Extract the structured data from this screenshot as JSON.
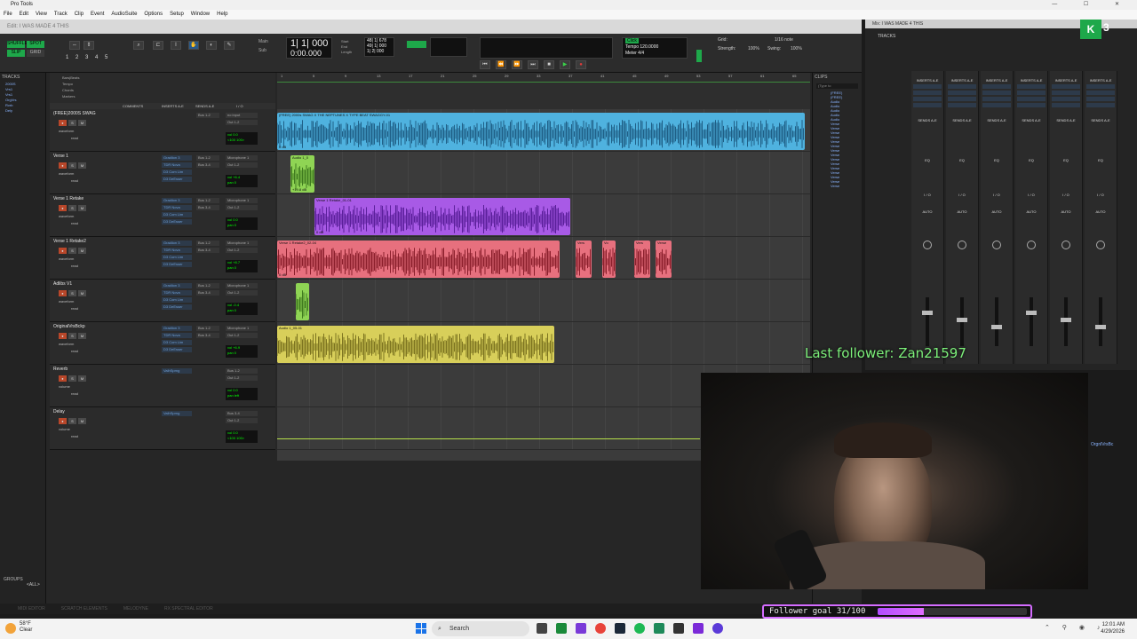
{
  "window_title": "Pro Tools",
  "menu": [
    "File",
    "Edit",
    "View",
    "Track",
    "Clip",
    "Event",
    "AudioSuite",
    "Options",
    "Setup",
    "Window",
    "Help"
  ],
  "edit_window_title": "Edit: I WAS MADE 4 THIS",
  "mix_window_title": "Mix: I WAS MADE 4 THIS",
  "transport": {
    "main_counter": "1| 1| 000",
    "sub_counter": "0:00.000",
    "start": "48| 1| 678",
    "end": "49| 1| 000",
    "length": "1| 2| 000",
    "main_label": "Main",
    "sub_label": "Sub",
    "tempo": "120.0000",
    "meter": "4/4",
    "grid_label": "Grid:",
    "grid_value": "1/16 note",
    "strength_label": "Strength:",
    "strength_value": "100%",
    "swing_label": "Swing:",
    "swing_value": "100%",
    "shuffle_label": "SHUFFLE",
    "spot_label": "SPOT",
    "slip_label": "SLIP",
    "grid_mode_label": "GRID",
    "counter_num": "1"
  },
  "ruler": {
    "bars_label": "Bars|Beats",
    "rows": [
      "Tempo",
      "Chords",
      "Markers"
    ],
    "bar_numbers": [
      "1",
      "5",
      "9",
      "13",
      "17",
      "21",
      "25",
      "29",
      "33",
      "37",
      "41",
      "45",
      "49",
      "53",
      "57",
      "61",
      "65"
    ]
  },
  "columns": {
    "comments": "COMMENTS",
    "inserts": "INSERTS A-E",
    "sends": "SENDS A-E",
    "io": "I / O"
  },
  "tracks_panel_label": "TRACKS",
  "groups_panel_label": "GROUPS",
  "groups_all_label": "<ALL>",
  "clips_panel_label": "CLIPS",
  "clips_search_placeholder": "(Type to",
  "clip_list": [
    "(FREE)",
    "(FREE)",
    "Audio",
    "Audio",
    "Audio",
    "Audio",
    "Audio",
    "Verse",
    "Verse",
    "Verse",
    "Verse",
    "Verse",
    "Verse",
    "Verse",
    "Verse",
    "Verse",
    "Verse",
    "Verse",
    "Verse",
    "Verse",
    "Verse",
    "Verse"
  ],
  "track_list": [
    "2000S",
    "Vrs1",
    "Vrs1",
    "OrgVrs",
    "Rvrb",
    "Dely"
  ],
  "tracks": [
    {
      "name": "(FREE)2000S SWAG",
      "color": "#4ba3d4",
      "inserts": [],
      "sends": [
        "Bus 1-2"
      ],
      "input": "no input",
      "output": "Out 1-2",
      "vol": "vol 0.0",
      "pan": "<100 100>",
      "view": "waveform",
      "mode": "read"
    },
    {
      "name": "Verse 1",
      "color": "#7fc74a",
      "inserts": [
        "Gradiion 3",
        "TDR Nova",
        "D3 Com Lim",
        "D3 DeEsser"
      ],
      "sends": [
        "Bus 1-2",
        "Bus 3-4"
      ],
      "input": "Microphone 1",
      "output": "Out 1-2",
      "vol": "vol +6.4",
      "pan": "pan 0",
      "view": "waveform",
      "mode": "read"
    },
    {
      "name": "Verse 1 Retake",
      "color": "#9b43e0",
      "inserts": [
        "Gradiion 3",
        "TDR Nova",
        "D3 Com Lim",
        "D3 DeEsser"
      ],
      "sends": [
        "Bus 1-2",
        "Bus 3-4"
      ],
      "input": "Microphone 1",
      "output": "Out 1-2",
      "vol": "vol 0.0",
      "pan": "pan 0",
      "view": "waveform",
      "mode": "read"
    },
    {
      "name": "Verse 1 Retake2",
      "color": "#e05c6b",
      "inserts": [
        "Gradiion 3",
        "TDR Nova",
        "D3 Com Lim",
        "D3 DeEsser"
      ],
      "sends": [
        "Bus 1-2",
        "Bus 3-4"
      ],
      "input": "Microphone 1",
      "output": "Out 1-2",
      "vol": "vol +8.7",
      "pan": "pan 0",
      "view": "waveform",
      "mode": "read"
    },
    {
      "name": "Adlibs V1",
      "color": "#7fc74a",
      "inserts": [
        "Gradiion 3",
        "TDR Nova",
        "D3 Com Lim",
        "D3 DeEsser"
      ],
      "sends": [
        "Bus 1-2",
        "Bus 3-4"
      ],
      "input": "Microphone 1",
      "output": "Out 1-2",
      "vol": "vol -0.4",
      "pan": "pan 0",
      "view": "waveform",
      "mode": "read"
    },
    {
      "name": "OriginalVrsBckp",
      "color": "#c9c04a",
      "inserts": [
        "Gradiion 3",
        "TDR Nova",
        "D3 Com Lim",
        "D3 DeEsser"
      ],
      "sends": [
        "Bus 1-2",
        "Bus 3-4"
      ],
      "input": "Microphone 1",
      "output": "Out 1-2",
      "vol": "vol +6.9",
      "pan": "pan 0",
      "view": "waveform",
      "mode": "read"
    },
    {
      "name": "Reverb",
      "color": "#7fc74a",
      "inserts": [
        "ValhSprng"
      ],
      "sends": [],
      "input": "Bus 1-2",
      "output": "Out 1-2",
      "vol": "vol 0.0",
      "pan": "pan left",
      "view": "volume",
      "mode": "read"
    },
    {
      "name": "Delay",
      "color": "#7fc74a",
      "inserts": [
        "ValhSprng"
      ],
      "sends": [],
      "input": "Bus 3-4",
      "output": "Out 1-2",
      "vol": "vol 0.0",
      "pan": "<100 100>",
      "view": "volume",
      "mode": "read"
    }
  ],
  "clips": [
    {
      "track": 0,
      "label": "(FREE) 2000s SWAG X THE NEPTUNES X TYPE BEAT SWAGGY-01",
      "color": "#4fb2df",
      "wave": "#1f5f86",
      "start": 0.0,
      "end": 0.99,
      "gain": "0 dB"
    },
    {
      "track": 1,
      "label": "Audio 1_0",
      "color": "#8fd454",
      "wave": "#3f7a1f",
      "start": 0.025,
      "end": 0.07,
      "gain": "+19.8 dB"
    },
    {
      "track": 2,
      "label": "Verse 1 Retake_01-01",
      "color": "#a85ae6",
      "wave": "#5a1f9a",
      "start": 0.07,
      "end": 0.55,
      "gain": "0 dB"
    },
    {
      "track": 3,
      "label": "Verse 1 Retake2_02-04",
      "color": "#e7707e",
      "wave": "#8b1f2c",
      "start": 0.0,
      "end": 0.53,
      "gain": "0 dB"
    },
    {
      "track": 3,
      "label": "Vers",
      "color": "#e7707e",
      "wave": "#8b1f2c",
      "start": 0.56,
      "end": 0.59,
      "gain": ""
    },
    {
      "track": 3,
      "label": "Vo",
      "color": "#e7707e",
      "wave": "#8b1f2c",
      "start": 0.61,
      "end": 0.635,
      "gain": ""
    },
    {
      "track": 3,
      "label": "Vers",
      "color": "#e7707e",
      "wave": "#8b1f2c",
      "start": 0.67,
      "end": 0.7,
      "gain": ""
    },
    {
      "track": 3,
      "label": "Verse",
      "color": "#e7707e",
      "wave": "#8b1f2c",
      "start": 0.71,
      "end": 0.74,
      "gain": ""
    },
    {
      "track": 4,
      "label": "",
      "color": "#8fd454",
      "wave": "#3f7a1f",
      "start": 0.035,
      "end": 0.06,
      "gain": ""
    },
    {
      "track": 5,
      "label": "Audio 1_05-01",
      "color": "#d8cf5a",
      "wave": "#7d7420",
      "start": 0.0,
      "end": 0.52,
      "gain": ""
    }
  ],
  "mixer": {
    "tracks_label": "TRACKS",
    "strips": [
      {
        "name": "Verse 1",
        "insert_head": "INSERTS A-E",
        "sends_head": "SENDS A-E",
        "eq": "EQ",
        "io": "I / O",
        "auto": "AUTO"
      },
      {
        "name": "Vrs1 Rtk",
        "insert_head": "INSERTS A-E",
        "sends_head": "SENDS A-E",
        "eq": "EQ",
        "io": "I / O",
        "auto": "AUTO"
      },
      {
        "name": "Vrs1 Rtk2",
        "insert_head": "INSERTS A-E",
        "sends_head": "SENDS A-E",
        "eq": "EQ",
        "io": "I / O",
        "auto": "AUTO"
      },
      {
        "name": "Adlibs",
        "insert_head": "INSERTS A-E",
        "sends_head": "SENDS A-E",
        "eq": "EQ",
        "io": "I / O",
        "auto": "AUTO"
      },
      {
        "name": "OrgnlVrsBc",
        "insert_head": "INSERTS A-E",
        "sends_head": "SENDS A-E",
        "eq": "EQ",
        "io": "I / O",
        "auto": "AUTO"
      },
      {
        "name": "Reverb",
        "insert_head": "INSERTS A-E",
        "sends_head": "SENDS A-E",
        "eq": "EQ",
        "io": "I / O",
        "auto": "AUTO"
      }
    ],
    "footer_label": "OrgnlVrsBc"
  },
  "bottom_tabs": [
    "MIDI EDITOR",
    "SCRATCH ELEMENTS",
    "MELODYNE",
    "RX SPECTRAL EDITOR"
  ],
  "overlay": {
    "last_follower": "Last follower: Zan21597",
    "goal_label": "Follower goal 31/100",
    "goal_progress": 0.31
  },
  "taskbar": {
    "weather_temp": "58°F",
    "weather_desc": "Clear",
    "search_label": "Search",
    "time": "12:01 AM",
    "date": "4/29/2026",
    "kick_badge": "3"
  }
}
